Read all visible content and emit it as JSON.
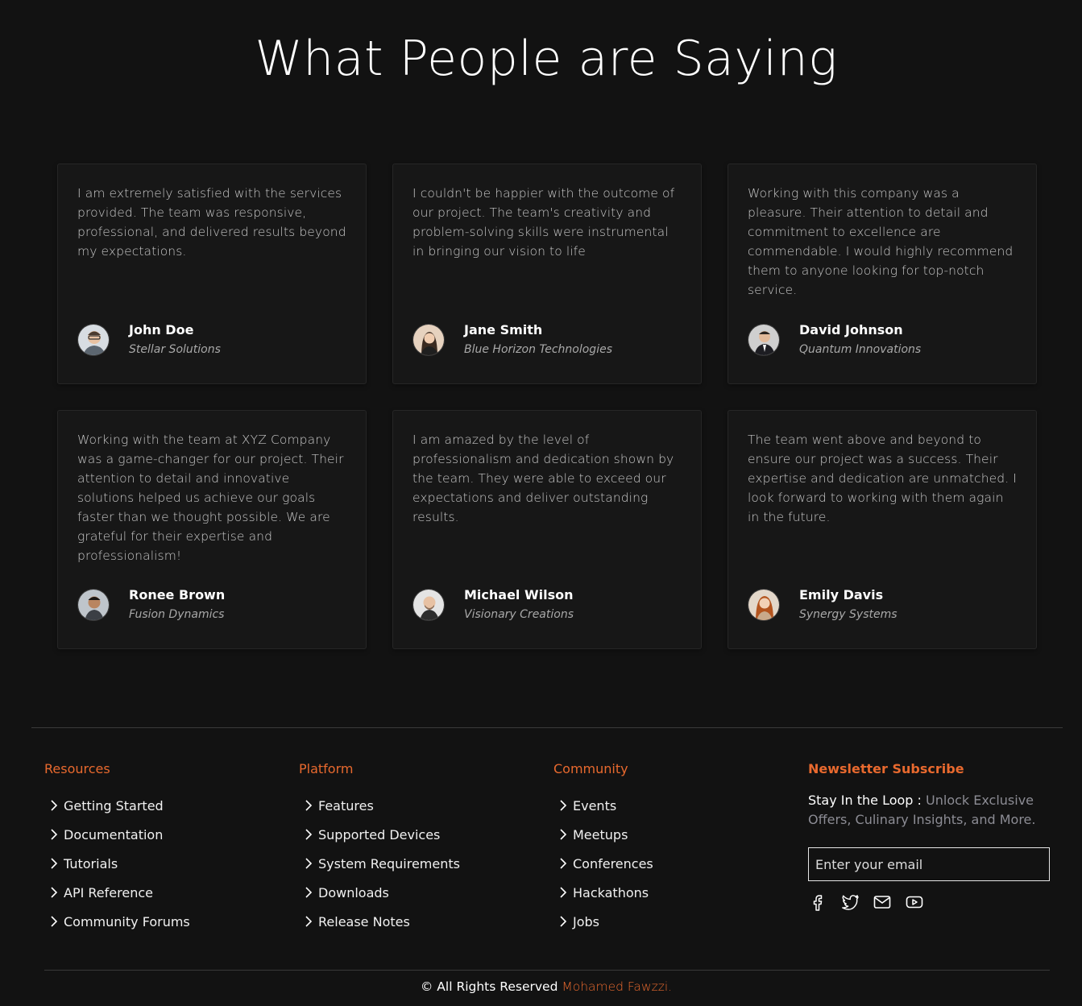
{
  "heading": "What People are Saying",
  "testimonials": [
    {
      "quote": "I am extremely satisfied with the services provided. The team was responsive, professional, and delivered results beyond my expectations.",
      "name": "John Doe",
      "company": "Stellar Solutions",
      "avatar_icon": "avatar-man-glasses"
    },
    {
      "quote": "I couldn't be happier with the outcome of our project. The team's creativity and problem-solving skills were instrumental in bringing our vision to life",
      "name": "Jane Smith",
      "company": "Blue Horizon Technologies",
      "avatar_icon": "avatar-woman"
    },
    {
      "quote": "Working with this company was a pleasure. Their attention to detail and commitment to excellence are commendable. I would highly recommend them to anyone looking for top-notch service.",
      "name": "David Johnson",
      "company": "Quantum Innovations",
      "avatar_icon": "avatar-man-suit"
    },
    {
      "quote": "Working with the team at XYZ Company was a game-changer for our project. Their attention to detail and innovative solutions helped us achieve our goals faster than we thought possible. We are grateful for their expertise and professionalism!",
      "name": "Ronee Brown",
      "company": "Fusion Dynamics",
      "avatar_icon": "avatar-man"
    },
    {
      "quote": "I am amazed by the level of professionalism and dedication shown by the team. They were able to exceed our expectations and deliver outstanding results.",
      "name": "Michael Wilson",
      "company": "Visionary Creations",
      "avatar_icon": "avatar-man-bald"
    },
    {
      "quote": "The team went above and beyond to ensure our project was a success. Their expertise and dedication are unmatched. I look forward to working with them again in the future.",
      "name": "Emily Davis",
      "company": "Synergy Systems",
      "avatar_icon": "avatar-woman-redhair"
    }
  ],
  "footer": {
    "resources": {
      "title": "Resources",
      "links": [
        "Getting Started",
        "Documentation",
        "Tutorials",
        "API Reference",
        "Community Forums"
      ]
    },
    "platform": {
      "title": "Platform",
      "links": [
        "Features",
        "Supported Devices",
        "System Requirements",
        "Downloads",
        "Release Notes"
      ]
    },
    "community": {
      "title": "Community",
      "links": [
        "Events",
        "Meetups",
        "Conferences",
        "Hackathons",
        "Jobs"
      ]
    },
    "newsletter": {
      "title": "Newsletter Subscribe",
      "lead": "Stay In the Loop :",
      "text": "Unlock Exclusive Offers, Culinary Insights, and More.",
      "email_placeholder": "Enter your email",
      "socials": [
        "facebook-icon",
        "twitter-icon",
        "mail-icon",
        "youtube-icon"
      ]
    }
  },
  "copyright": {
    "text": "© All Rights Reserved",
    "author": "Mohamed Fawzzi."
  },
  "colors": {
    "accent": "#e8692e",
    "background": "#121212",
    "card": "#171717"
  }
}
